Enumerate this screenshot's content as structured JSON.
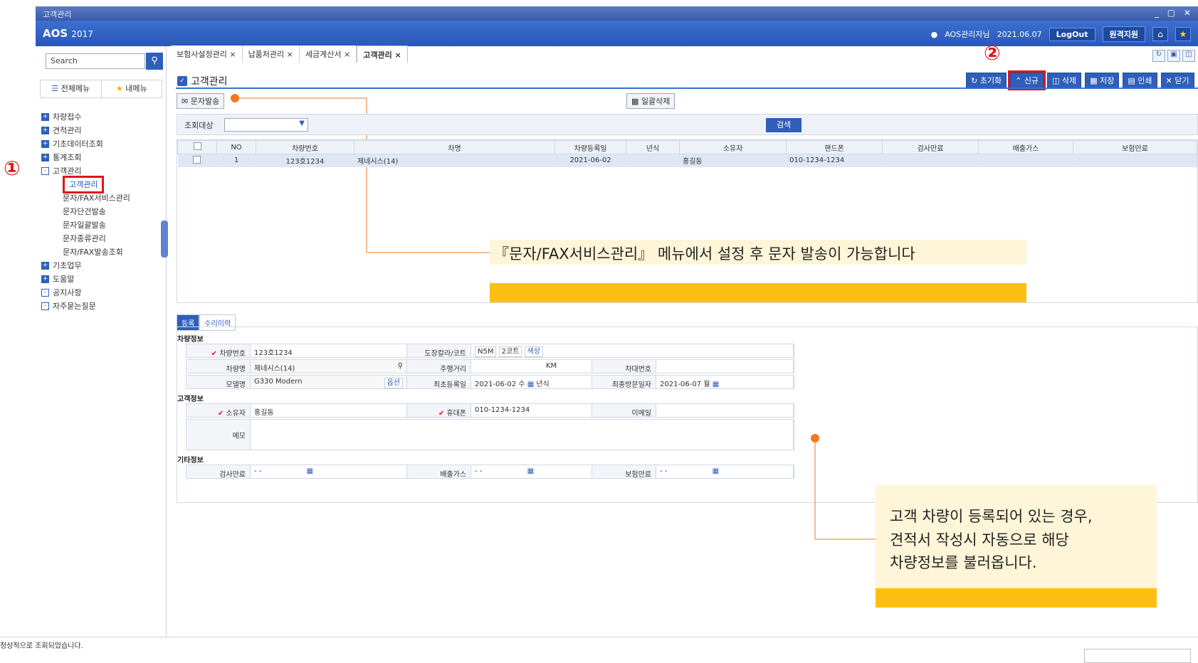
{
  "window": {
    "title": "고객관리",
    "controls": "_ ▢ ✕"
  },
  "app": {
    "logo": "AOS",
    "year": "2017",
    "user": "AOS관리자님",
    "date": "2021.06.07",
    "logout": "LogOut",
    "remote": "원격지원"
  },
  "sidebar": {
    "search_placeholder": "Search",
    "tab_all": "전체메뉴",
    "tab_my": "내메뉴",
    "items": [
      "차량접수",
      "견적관리",
      "기초데이터조회",
      "통계조회",
      "고객관리"
    ],
    "sub": [
      "고객관리",
      "문자/FAX서비스관리",
      "문자단건발송",
      "문자일괄발송",
      "문자종류관리",
      "문자/FAX발송조회"
    ],
    "items2": [
      "기초업무",
      "도움말",
      "공지사항",
      "자주묻는질문"
    ]
  },
  "markers": {
    "one": "①",
    "two": "②"
  },
  "tabs": [
    "보험사설정관리",
    "납품처관리",
    "세금계산서",
    "고객관리"
  ],
  "page": {
    "title": "고객관리",
    "reset": "초기화",
    "new": "신규",
    "delete": "삭제",
    "save": "저장",
    "print": "인쇄",
    "close": "닫기",
    "sms": "문자발송",
    "delall": "일괄삭제",
    "query_label": "조회대상",
    "query_btn": "검색"
  },
  "grid": {
    "headers": [
      "NO",
      "차량번호",
      "차명",
      "차량등록일",
      "년식",
      "소유자",
      "핸드폰",
      "검사만료",
      "배출가스",
      "보험만료"
    ],
    "rows": [
      [
        "1",
        "123호1234",
        "제네시스(14)",
        "2021-06-02",
        "",
        "홍길동",
        "010-1234-1234",
        "",
        "",
        ""
      ]
    ]
  },
  "detail": {
    "tab_reg": "등록",
    "tab_repair": "수리이력",
    "sec_car": "차량정보",
    "sec_cust": "고객정보",
    "sec_etc": "기타정보",
    "lbl_carno": "차량번호",
    "val_carno": "123호1234",
    "lbl_color": "도장칼라/코트",
    "val_color": "N5M",
    "val_coat": "2코트",
    "btn_colorname": "색상",
    "lbl_carname": "차량명",
    "val_carname": "제네시스(14)",
    "lbl_mileage": "주행거리",
    "unit_km": "KM",
    "lbl_vin": "차대번호",
    "lbl_model": "모델명",
    "val_model": "G330 Modern",
    "btn_option": "옵션",
    "lbl_firstreg": "최초등록일",
    "val_firstreg": "2021-06-02 수",
    "unit_year": "년식",
    "lbl_lastvisit": "최종방문일자",
    "val_lastvisit": "2021-06-07 월",
    "lbl_owner": "소유자",
    "val_owner": "홍길동",
    "lbl_phone": "휴대폰",
    "val_phone": "010-1234-1234",
    "lbl_email": "이메일",
    "lbl_memo": "메모",
    "lbl_inspect": "검사만료",
    "lbl_emission": "배출가스",
    "lbl_insure": "보험만료",
    "date_blank": "- -"
  },
  "callouts": {
    "one": "『문자/FAX서비스관리』 메뉴에서 설정 후 문자 발송이 가능합니다",
    "two_l1": "고객 차량이 등록되어 있는 경우,",
    "two_l2": "견적서 작성시 자동으로 해당",
    "two_l3": "차량정보를 불러옵니다."
  },
  "status": "정상적으로 조회되었습니다."
}
